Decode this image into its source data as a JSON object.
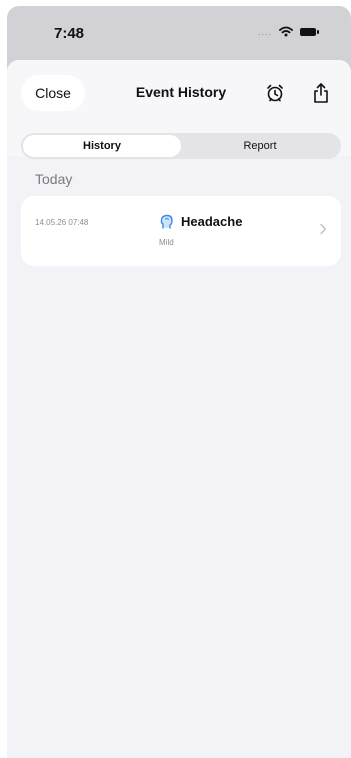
{
  "status_bar": {
    "time": "7:48",
    "signal": "....",
    "wifi_icon": "wifi-icon",
    "battery_icon": "battery-icon"
  },
  "header": {
    "close_label": "Close",
    "title": "Event History",
    "alarm_icon": "alarm-clock-icon",
    "share_icon": "share-icon"
  },
  "tabs": [
    {
      "label": "History",
      "selected": true
    },
    {
      "label": "Report",
      "selected": false
    }
  ],
  "section": {
    "title": "Today"
  },
  "events": [
    {
      "datetime": "14.05.26 07:48",
      "name": "Headache",
      "severity": "Mild",
      "icon": "head-icon"
    }
  ],
  "colors": {
    "accent": "#3e8be5",
    "background": "#f2f2f7",
    "card": "#ffffff"
  }
}
